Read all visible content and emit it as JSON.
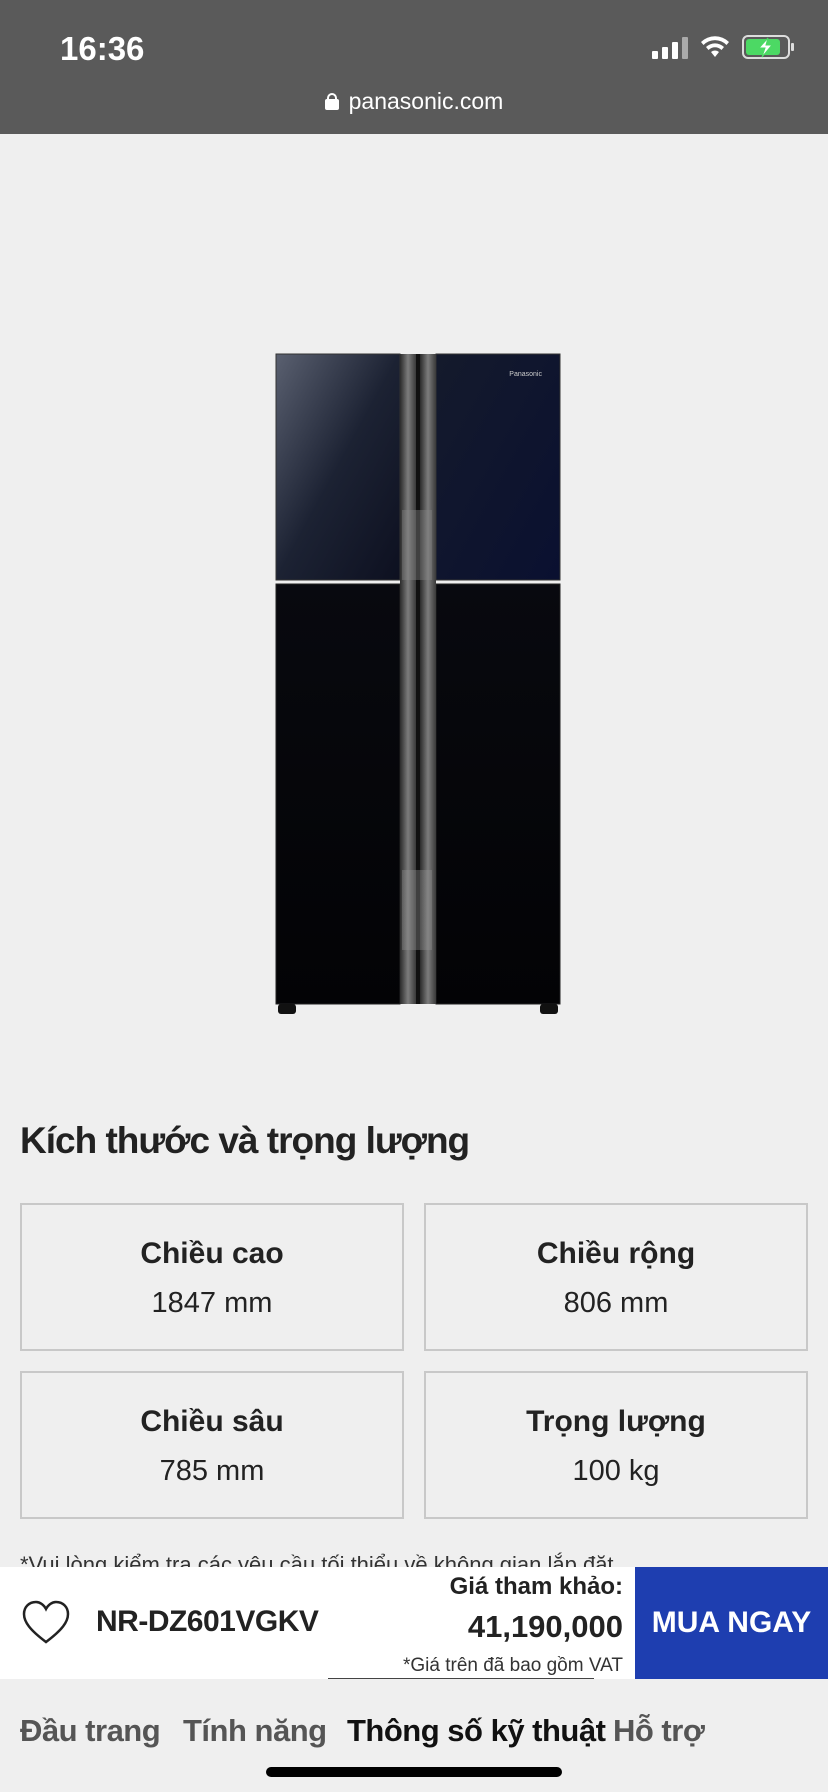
{
  "status_bar": {
    "time": "16:36"
  },
  "browser": {
    "url": "panasonic.com"
  },
  "product_image": {
    "alt": "",
    "brand_mark": "Panasonic"
  },
  "dimensions": {
    "title": "Kích thước và trọng lượng",
    "items": [
      {
        "label": "Chiều cao",
        "value": "1847 mm"
      },
      {
        "label": "Chiều rộng",
        "value": "806 mm"
      },
      {
        "label": "Chiều sâu",
        "value": "785 mm"
      },
      {
        "label": "Trọng lượng",
        "value": "100 kg"
      }
    ],
    "note": "*Vui lòng kiểm tra các yêu cầu tối thiểu về không gian lắp đặt"
  },
  "buybar": {
    "model": "NR-DZ601VGKV",
    "price_label": "Giá tham khảo:",
    "price": "41,190,000",
    "vat_note": "*Giá trên đã bao gồm VAT",
    "buy_label": "MUA NGAY"
  },
  "bottom_nav": {
    "items": [
      {
        "label": "Đầu trang"
      },
      {
        "label": "Tính năng"
      },
      {
        "label": "Thông số kỹ thuật"
      },
      {
        "label": "Hỗ trợ"
      }
    ],
    "active_index": 2
  },
  "colors": {
    "accent": "#1e3eb0",
    "topbar": "#5a5a5a",
    "background": "#efefef"
  }
}
